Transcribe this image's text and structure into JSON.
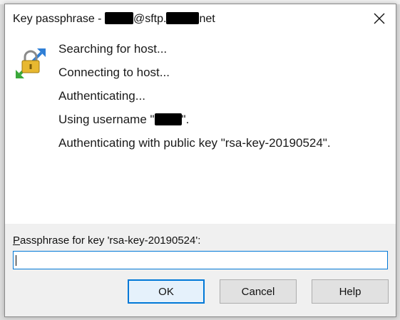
{
  "window": {
    "title_prefix": "Key passphrase - ",
    "title_middle": "@sftp.",
    "title_suffix": "net"
  },
  "icons": {
    "close": "close-icon",
    "app": "key-lock-icon"
  },
  "log": [
    "Searching for host...",
    "Connecting to host...",
    "Authenticating...",
    "Using username \"",
    "Authenticating with public key \"rsa-key-20190524\"."
  ],
  "log_username_suffix": "\".",
  "prompt": {
    "accel": "P",
    "label_rest": "assphrase for key 'rsa-key-20190524':",
    "value": ""
  },
  "buttons": {
    "ok": "OK",
    "cancel": "Cancel",
    "help": "Help"
  },
  "colors": {
    "accent": "#0078d7",
    "footer_bg": "#f0f0f0",
    "button_bg": "#e1e1e1"
  }
}
